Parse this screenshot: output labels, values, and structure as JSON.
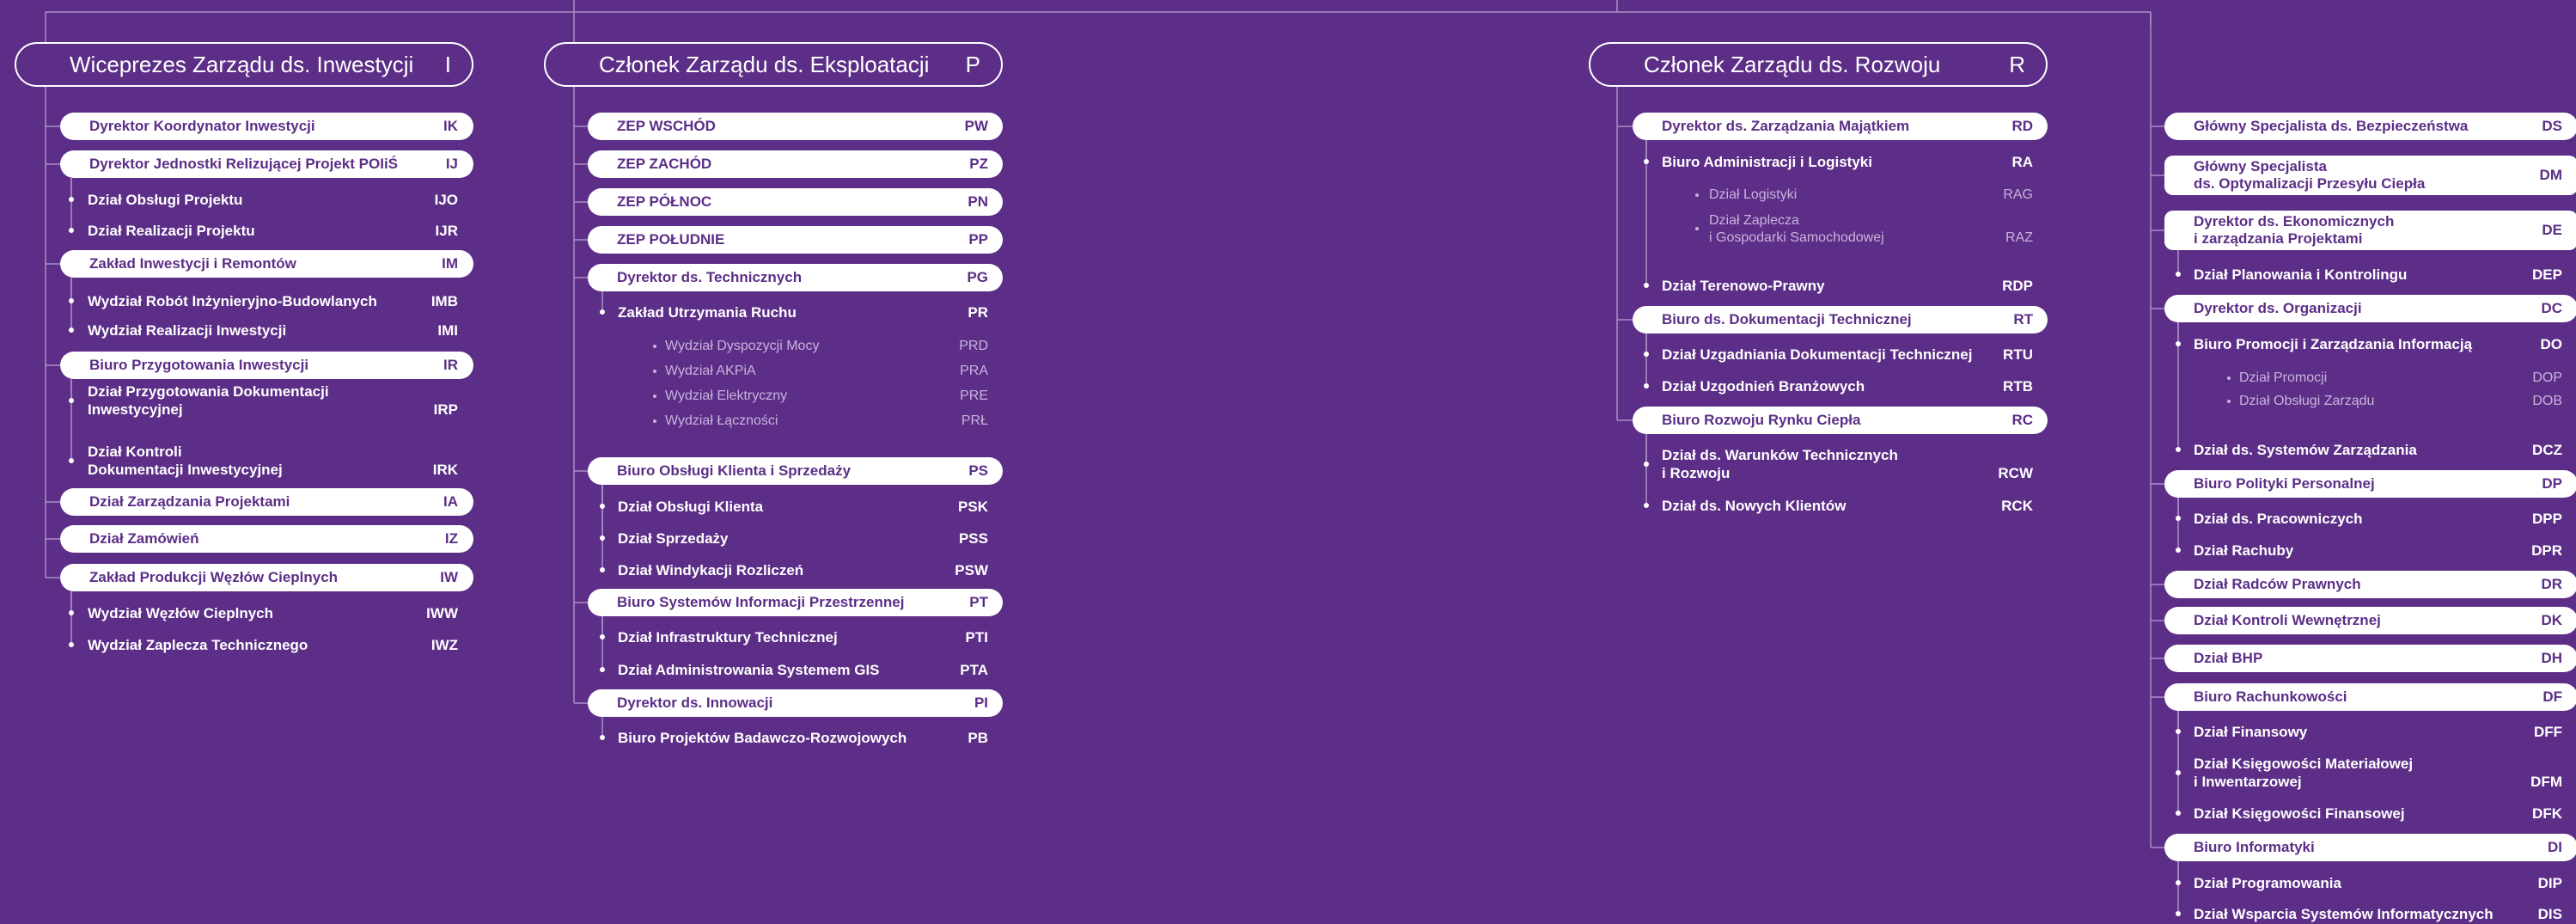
{
  "columns": [
    {
      "head": {
        "label": "Wiceprezes Zarządu ds. Inwestycji",
        "code": "I"
      },
      "items": [
        {
          "kind": "pill",
          "label": "Dyrektor Koordynator Inwestycji",
          "code": "IK"
        },
        {
          "kind": "pill",
          "label": "Dyrektor Jednostki Relizującej Projekt POIiŚ",
          "code": "IJ"
        },
        {
          "kind": "row",
          "label": "Dział Obsługi Projektu",
          "code": "IJO"
        },
        {
          "kind": "row",
          "label": "Dział Realizacji Projektu",
          "code": "IJR"
        },
        {
          "kind": "pill",
          "label": "Zakład Inwestycji i Remontów",
          "code": "IM"
        },
        {
          "kind": "row",
          "label": "Wydział Robót Inżynieryjno-Budowlanych",
          "code": "IMB"
        },
        {
          "kind": "row",
          "label": "Wydział Realizacji Inwestycji",
          "code": "IMI"
        },
        {
          "kind": "pill",
          "label": "Biuro Przygotowania Inwestycji",
          "code": "IR"
        },
        {
          "kind": "row",
          "label": "Dział Przygotowania Dokumentacji",
          "label2": "Inwestycyjnej",
          "code": "IRP"
        },
        {
          "kind": "row",
          "label": "Dział Kontroli",
          "label2": "Dokumentacji Inwestycyjnej",
          "code": "IRK"
        },
        {
          "kind": "pill",
          "label": "Dział Zarządzania Projektami",
          "code": "IA"
        },
        {
          "kind": "pill",
          "label": "Dział Zamówień",
          "code": "IZ"
        },
        {
          "kind": "pill",
          "label": "Zakład Produkcji Węzłów Cieplnych",
          "code": "IW"
        },
        {
          "kind": "row",
          "label": "Wydział Węzłów Cieplnych",
          "code": "IWW"
        },
        {
          "kind": "row",
          "label": "Wydział Zaplecza Technicznego",
          "code": "IWZ"
        }
      ]
    },
    {
      "head": {
        "label": "Członek Zarządu ds. Eksploatacji",
        "code": "P"
      },
      "items": [
        {
          "kind": "pill",
          "label": "ZEP WSCHÓD",
          "code": "PW"
        },
        {
          "kind": "pill",
          "label": "ZEP ZACHÓD",
          "code": "PZ"
        },
        {
          "kind": "pill",
          "label": "ZEP PÓŁNOC",
          "code": "PN"
        },
        {
          "kind": "pill",
          "label": "ZEP POŁUDNIE",
          "code": "PP"
        },
        {
          "kind": "pill",
          "label": "Dyrektor ds. Technicznych",
          "code": "PG"
        },
        {
          "kind": "row",
          "label": "Zakład Utrzymania Ruchu",
          "code": "PR"
        },
        {
          "kind": "sub",
          "label": "Wydział Dyspozycji Mocy",
          "code": "PRD"
        },
        {
          "kind": "sub",
          "label": "Wydział AKPiA",
          "code": "PRA"
        },
        {
          "kind": "sub",
          "label": "Wydział Elektryczny",
          "code": "PRE"
        },
        {
          "kind": "sub",
          "label": "Wydział Łączności",
          "code": "PRŁ"
        },
        {
          "kind": "pill",
          "label": "Biuro Obsługi Klienta i Sprzedaży",
          "code": "PS"
        },
        {
          "kind": "row",
          "label": "Dział Obsługi Klienta",
          "code": "PSK"
        },
        {
          "kind": "row",
          "label": "Dział Sprzedaży",
          "code": "PSS"
        },
        {
          "kind": "row",
          "label": "Dział Windykacji Rozliczeń",
          "code": "PSW"
        },
        {
          "kind": "pill",
          "label": "Biuro Systemów Informacji Przestrzennej",
          "code": "PT"
        },
        {
          "kind": "row",
          "label": "Dział Infrastruktury Technicznej",
          "code": "PTI"
        },
        {
          "kind": "row",
          "label": "Dział Administrowania Systemem GIS",
          "code": "PTA"
        },
        {
          "kind": "pill",
          "label": "Dyrektor ds. Innowacji",
          "code": "PI"
        },
        {
          "kind": "row",
          "label": "Biuro Projektów Badawczo-Rozwojowych",
          "code": "PB"
        }
      ]
    },
    {
      "head": {
        "label": "Członek Zarządu ds. Rozwoju",
        "code": "R"
      },
      "items": [
        {
          "kind": "pill",
          "label": "Dyrektor ds. Zarządzania Majątkiem",
          "code": "RD"
        },
        {
          "kind": "row",
          "label": "Biuro Administracji i Logistyki",
          "code": "RA"
        },
        {
          "kind": "sub",
          "label": "Dział Logistyki",
          "code": "RAG"
        },
        {
          "kind": "sub",
          "label": "Dział Zaplecza",
          "label2": "i Gospodarki Samochodowej",
          "code": "RAZ"
        },
        {
          "kind": "row",
          "label": "Dział Terenowo-Prawny",
          "code": "RDP"
        },
        {
          "kind": "pill",
          "label": "Biuro ds. Dokumentacji Technicznej",
          "code": "RT"
        },
        {
          "kind": "row",
          "label": "Dział Uzgadniania Dokumentacji Technicznej",
          "code": "RTU"
        },
        {
          "kind": "row",
          "label": "Dział Uzgodnień Branżowych",
          "code": "RTB"
        },
        {
          "kind": "pill",
          "label": "Biuro Rozwoju Rynku Ciepła",
          "code": "RC"
        },
        {
          "kind": "row",
          "label": "Dział ds. Warunków Technicznych",
          "label2": "i Rozwoju",
          "code": "RCW"
        },
        {
          "kind": "row",
          "label": "Dział ds. Nowych Klientów",
          "code": "RCK"
        }
      ]
    },
    {
      "head": null,
      "items": [
        {
          "kind": "pill",
          "label": "Główny Specjalista ds. Bezpieczeństwa",
          "code": "DS"
        },
        {
          "kind": "pill",
          "label": "Główny Specjalista",
          "label2": "ds. Optymalizacji Przesyłu Ciepła",
          "code": "DM"
        },
        {
          "kind": "pill",
          "label": "Dyrektor ds. Ekonomicznych",
          "label2": "i zarządzania Projektami",
          "code": "DE"
        },
        {
          "kind": "row",
          "label": "Dział Planowania i Kontrolingu",
          "code": "DEP"
        },
        {
          "kind": "pill",
          "label": "Dyrektor ds. Organizacji",
          "code": "DC"
        },
        {
          "kind": "row",
          "label": "Biuro Promocji i Zarządzania Informacją",
          "code": "DO"
        },
        {
          "kind": "sub",
          "label": "Dział Promocji",
          "code": "DOP"
        },
        {
          "kind": "sub",
          "label": "Dział Obsługi Zarządu",
          "code": "DOB"
        },
        {
          "kind": "row",
          "label": "Dział ds. Systemów Zarządzania",
          "code": "DCZ"
        },
        {
          "kind": "pill",
          "label": "Biuro Polityki Personalnej",
          "code": "DP"
        },
        {
          "kind": "row",
          "label": "Dział ds. Pracowniczych",
          "code": "DPP"
        },
        {
          "kind": "row",
          "label": "Dział Rachuby",
          "code": "DPR"
        },
        {
          "kind": "pill",
          "label": "Dział Radców Prawnych",
          "code": "DR"
        },
        {
          "kind": "pill",
          "label": "Dział Kontroli Wewnętrznej",
          "code": "DK"
        },
        {
          "kind": "pill",
          "label": "Dział BHP",
          "code": "DH"
        },
        {
          "kind": "pill",
          "label": "Biuro Rachunkowości",
          "code": "DF"
        },
        {
          "kind": "row",
          "label": "Dział Finansowy",
          "code": "DFF"
        },
        {
          "kind": "row",
          "label": "Dział Księgowości Materiałowej",
          "label2": "i Inwentarzowej",
          "code": "DFM"
        },
        {
          "kind": "row",
          "label": "Dział Księgowości Finansowej",
          "code": "DFK"
        },
        {
          "kind": "pill",
          "label": "Biuro Informatyki",
          "code": "DI"
        },
        {
          "kind": "row",
          "label": "Dział Programowania",
          "code": "DIP"
        },
        {
          "kind": "row",
          "label": "Dział Wsparcia Systemów Informatycznych",
          "code": "DIS"
        }
      ]
    }
  ]
}
